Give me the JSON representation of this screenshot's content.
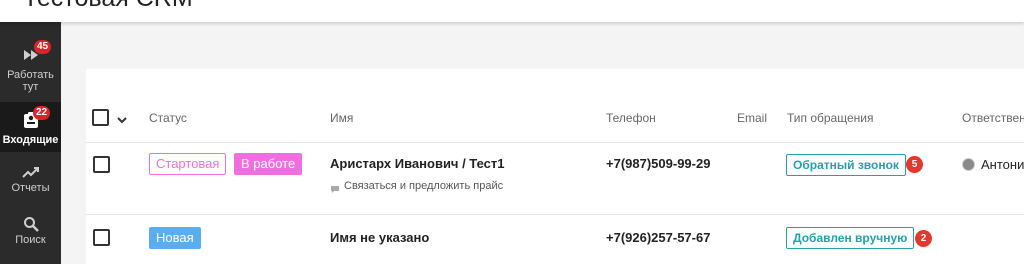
{
  "header": {
    "title": "Тестовая CRM"
  },
  "sidebar": {
    "items": [
      {
        "label_line1": "Работать",
        "label_line2": "тут",
        "icon": "fast-forward-icon",
        "badge": "45",
        "active": false
      },
      {
        "label": "Входящие",
        "icon": "inbox-icon",
        "badge": "22",
        "active": true
      },
      {
        "label": "Отчеты",
        "icon": "trend-chart-icon",
        "active": false
      },
      {
        "label": "Поиск",
        "icon": "search-icon",
        "active": false
      }
    ]
  },
  "table": {
    "columns": [
      "Статус",
      "Имя",
      "Телефон",
      "Email",
      "Тип обращения",
      "Ответствен"
    ],
    "rows": [
      {
        "statuses": [
          "Стартовая",
          "В работе"
        ],
        "name": "Аристарх Иванович / Тест1",
        "task": "Связаться и предложить прайс",
        "phone": "+7(987)509-99-29",
        "email": "",
        "type": "Обратный звонок",
        "type_count": "5",
        "responsible": "Антонин"
      },
      {
        "statuses": [
          "Новая"
        ],
        "name": "Имя не указано",
        "task": "",
        "phone": "+7(926)257-57-67",
        "email": "",
        "type": "Добавлен вручную",
        "type_count": "2",
        "responsible": ""
      }
    ]
  },
  "colors": {
    "sidebar_bg": "#2b2b2b",
    "badge_red": "#e0202a",
    "pink": "#f06fe0",
    "blue": "#5aaef0",
    "teal": "#26a0a8"
  }
}
